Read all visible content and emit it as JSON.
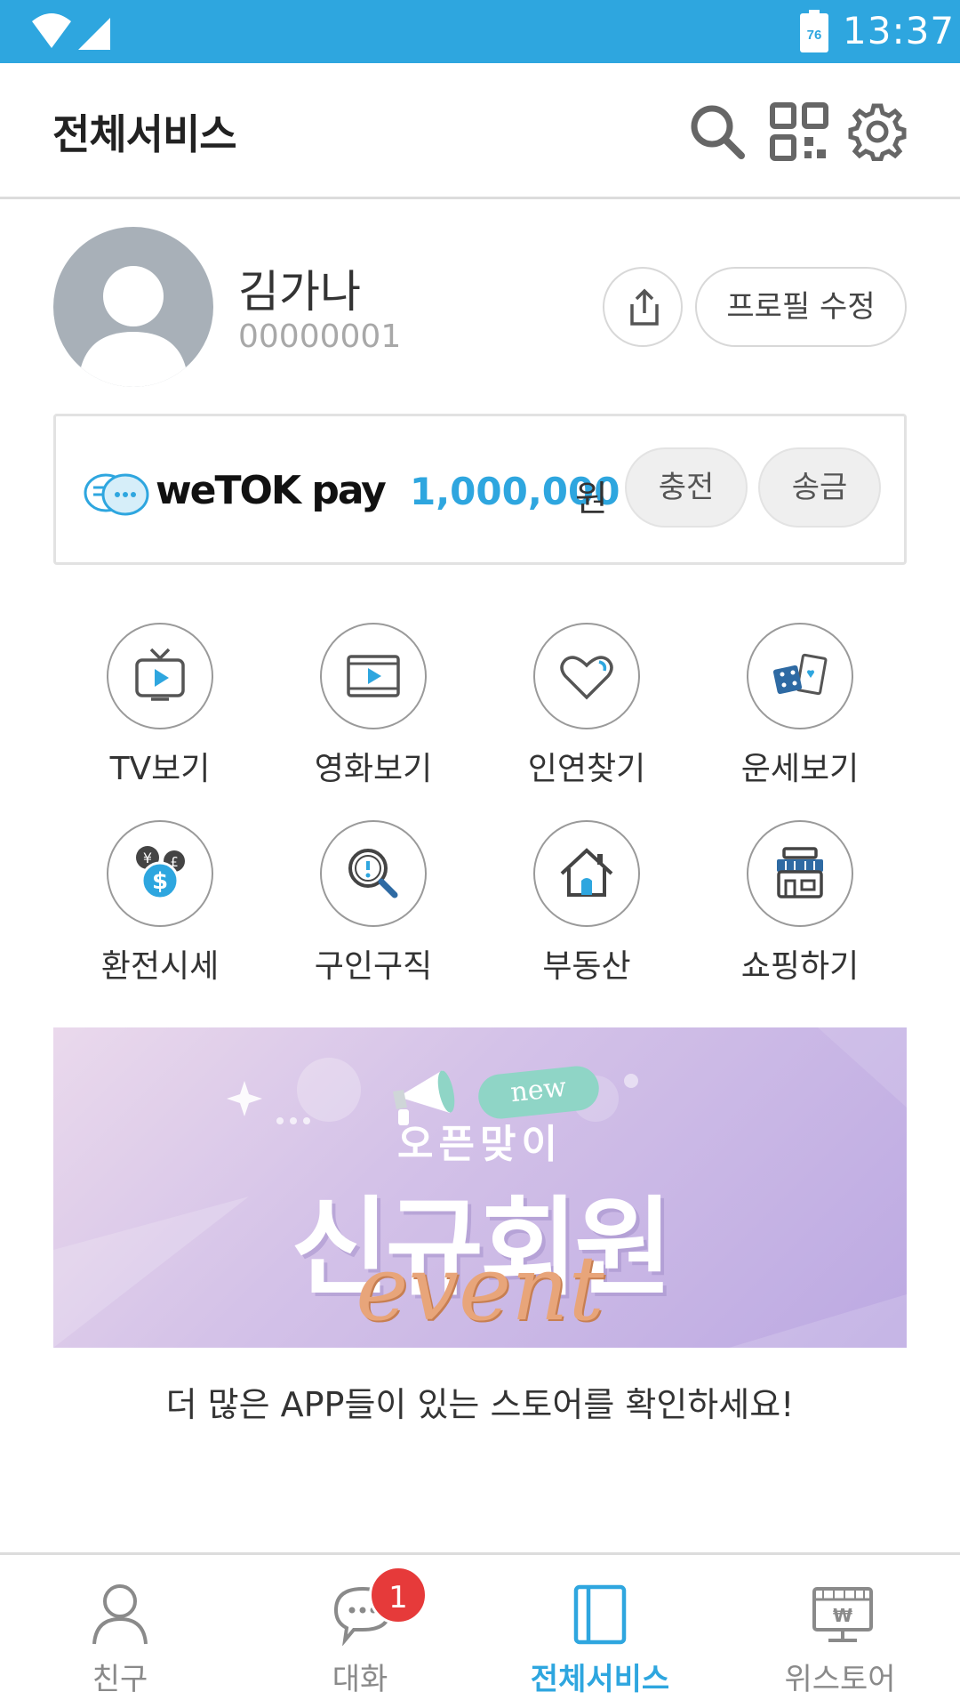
{
  "status_bar": {
    "time": "13:37",
    "battery": "76",
    "bg_color": "#2ea6df"
  },
  "header": {
    "title": "전체서비스",
    "icons": [
      "search-icon",
      "qr-code-icon",
      "settings-gear-icon"
    ]
  },
  "profile": {
    "name": "김가나",
    "id": "00000001",
    "edit_label": "프로필 수정"
  },
  "pay": {
    "brand": "weTOK pay",
    "amount": "1,000,000",
    "unit": "원",
    "charge_label": "충전",
    "send_label": "송금"
  },
  "services": [
    {
      "label": "TV보기",
      "icon": "tv-icon"
    },
    {
      "label": "영화보기",
      "icon": "movie-icon"
    },
    {
      "label": "인연찾기",
      "icon": "heart-icon"
    },
    {
      "label": "운세보기",
      "icon": "dice-cards-icon"
    },
    {
      "label": "환전시세",
      "icon": "currency-icon"
    },
    {
      "label": "구인구직",
      "icon": "job-search-icon"
    },
    {
      "label": "부동산",
      "icon": "house-icon"
    },
    {
      "label": "쇼핑하기",
      "icon": "shop-icon"
    }
  ],
  "banner": {
    "tag": "new",
    "subtitle": "오픈맞이",
    "title": "신규회원",
    "event": "event"
  },
  "store_link": "더 많은 APP들이 있는 스토어를 확인하세요!",
  "bottom_nav": [
    {
      "label": "친구",
      "icon": "person-icon",
      "active": false
    },
    {
      "label": "대화",
      "icon": "chat-icon",
      "active": false,
      "badge": "1"
    },
    {
      "label": "전체서비스",
      "icon": "all-services-icon",
      "active": true
    },
    {
      "label": "위스토어",
      "icon": "store-icon",
      "active": false
    }
  ],
  "colors": {
    "accent": "#2ea6df",
    "badge": "#e63a3a"
  }
}
